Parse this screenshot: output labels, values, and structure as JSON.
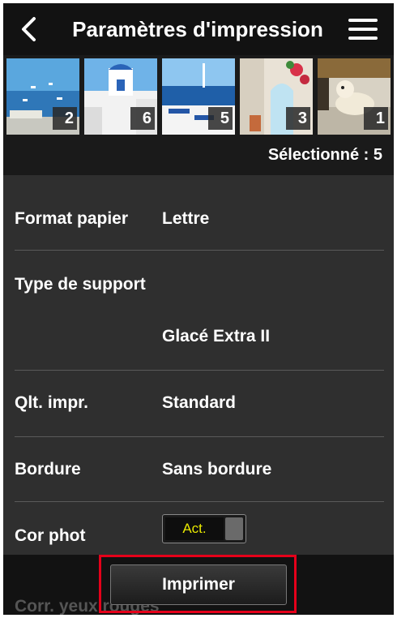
{
  "header": {
    "title": "Paramètres d'impression",
    "back_icon": "chevron-left-icon",
    "menu_icon": "hamburger-menu-icon"
  },
  "thumbnails": [
    {
      "count": "2",
      "scene": "harbor-boats"
    },
    {
      "count": "6",
      "scene": "white-chapel"
    },
    {
      "count": "5",
      "scene": "sea-terrace"
    },
    {
      "count": "3",
      "scene": "flower-doorway"
    },
    {
      "count": "1",
      "scene": "dog-on-steps"
    }
  ],
  "selection": {
    "text": "Sélectionné : 5"
  },
  "settings": {
    "paper_size": {
      "label": "Format papier",
      "value": "Lettre"
    },
    "media_type": {
      "label": "Type de support",
      "value": "Glacé Extra II"
    },
    "print_quality": {
      "label": "Qlt. impr.",
      "value": "Standard"
    },
    "border": {
      "label": "Bordure",
      "value": "Sans bordure"
    },
    "photo_correction": {
      "label": "Cor phot",
      "toggle": "Act."
    },
    "red_eye": {
      "label": "Corr. yeux rouges"
    }
  },
  "footer": {
    "print_button": "Imprimer"
  },
  "colors": {
    "background": "#2f2f2f",
    "header": "#121212",
    "toggle_text": "#e8e800",
    "highlight": "#e5001a"
  }
}
